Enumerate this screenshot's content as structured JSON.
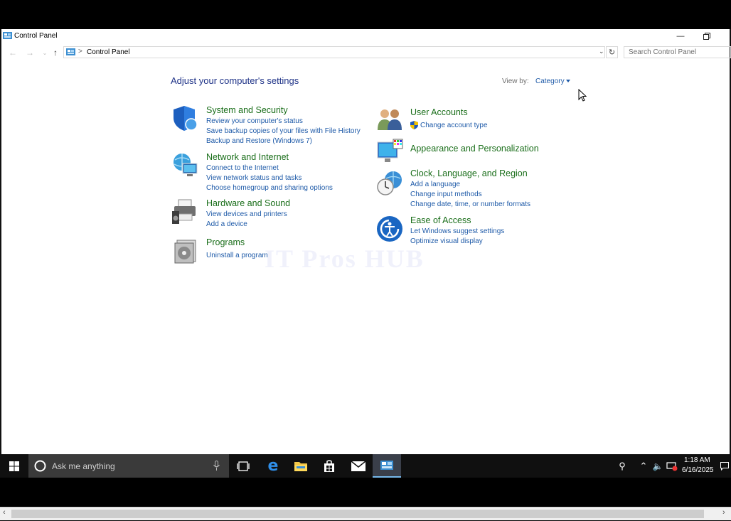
{
  "window": {
    "title": "Control Panel",
    "minimize_icon": "minimize-icon",
    "restore_icon": "restore-icon"
  },
  "navbar": {
    "address_text": "Control Panel",
    "separator": ">",
    "search_placeholder": "Search Control Panel"
  },
  "content": {
    "heading": "Adjust your computer's settings",
    "view_by_label": "View by:",
    "view_by_value": "Category"
  },
  "categories": [
    {
      "title": "System and Security",
      "icon": "shield-icon",
      "links": [
        "Review your computer's status",
        "Save backup copies of your files with File History",
        "Backup and Restore (Windows 7)"
      ]
    },
    {
      "title": "Network and Internet",
      "icon": "network-globe-icon",
      "links": [
        "Connect to the Internet",
        "View network status and tasks",
        "Choose homegroup and sharing options"
      ]
    },
    {
      "title": "Hardware and Sound",
      "icon": "printer-speaker-icon",
      "links": [
        "View devices and printers",
        "Add a device"
      ]
    },
    {
      "title": "Programs",
      "icon": "programs-disc-icon",
      "links": [
        "Uninstall a program"
      ]
    },
    {
      "title": "User Accounts",
      "icon": "users-icon",
      "links": [
        "Change account type"
      ]
    },
    {
      "title": "Appearance and Personalization",
      "icon": "monitor-palette-icon",
      "links": []
    },
    {
      "title": "Clock, Language, and Region",
      "icon": "clock-globe-icon",
      "links": [
        "Add a language",
        "Change input methods",
        "Change date, time, or number formats"
      ]
    },
    {
      "title": "Ease of Access",
      "icon": "ease-of-access-icon",
      "links": [
        "Let Windows suggest settings",
        "Optimize visual display"
      ]
    }
  ],
  "watermark": "IT Pros HUB",
  "taskbar": {
    "search_text": "Ask me anything",
    "time": "1:18 AM",
    "date": "6/16/2025"
  },
  "colors": {
    "category_title": "#1a6e1a",
    "link": "#1e5aa8",
    "heading": "#1e3287",
    "taskbar": "#101010"
  }
}
